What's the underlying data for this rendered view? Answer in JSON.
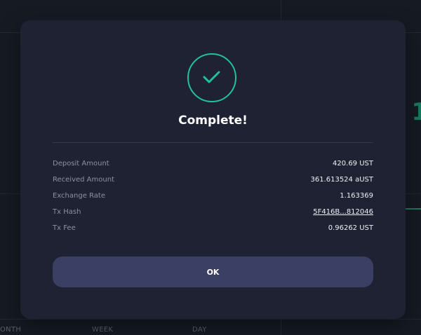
{
  "background": {
    "tabs": [
      "ONTH",
      "WEEK",
      "DAY"
    ],
    "value_fragment": "1"
  },
  "dialog": {
    "status_icon": "check-icon",
    "title": "Complete!",
    "rows": [
      {
        "label": "Deposit Amount",
        "value": "420.69 UST"
      },
      {
        "label": "Received Amount",
        "value": "361.613524 aUST"
      },
      {
        "label": "Exchange Rate",
        "value": "1.163369"
      },
      {
        "label": "Tx Hash",
        "value": "5F416B...812046"
      },
      {
        "label": "Tx Fee",
        "value": "0.96262 UST"
      }
    ],
    "ok_label": "OK"
  },
  "colors": {
    "accent": "#1fc39a",
    "dialog_bg": "#1f2233",
    "button_bg": "#3b3f63"
  }
}
